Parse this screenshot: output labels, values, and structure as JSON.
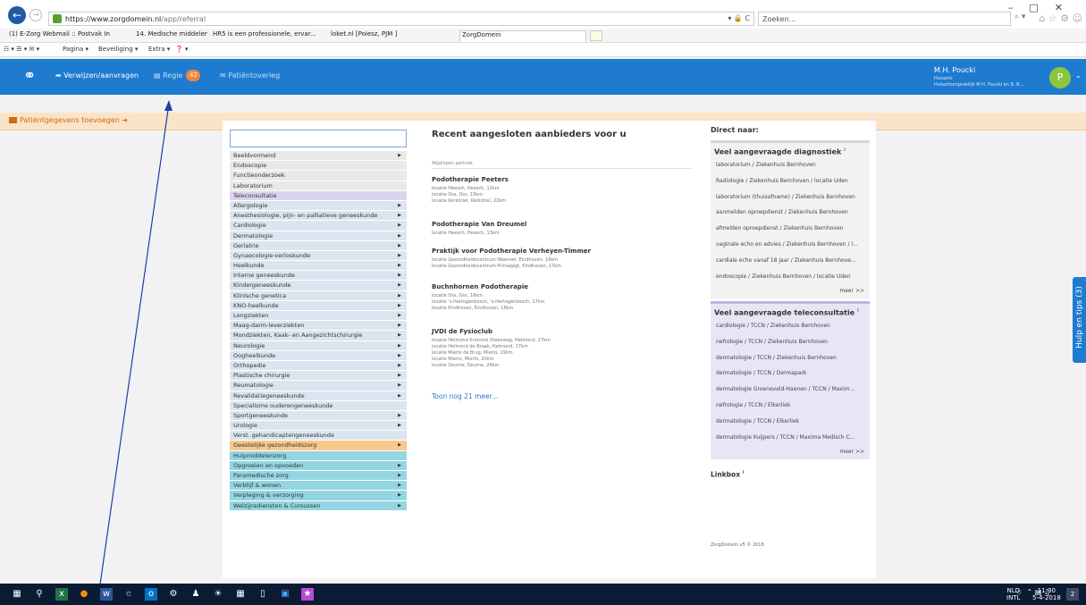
{
  "browser": {
    "url_host": "https://www.zorgdomein.nl",
    "url_path": "/app/referral",
    "url_tools": "▾ 🔒 C",
    "search_placeholder": "Zoeken...",
    "search_tools": "⌕ ▾",
    "tabs": [
      "(1) E-Zorg Webmail :: Postvak In",
      "14. Medische middelen",
      "HR5 is een professionele, ervar...",
      "loket.nl [Poiesz, PJM ]",
      "ZorgDomein"
    ],
    "command_items": [
      "Pagina ▾",
      "Beveiliging ▾",
      "Extra ▾"
    ]
  },
  "app": {
    "nav": {
      "referral": "Verwijzen/aanvragen",
      "regie": "Regie",
      "regie_count": "42",
      "patient_consult": "Patiëntoverleg"
    },
    "user": {
      "name": "M.H. Poucki",
      "role": "Huisarts",
      "practice": "Huisartsenpraktijk M.H. Poucki en B. R...",
      "initial": "P"
    },
    "add_patient": "Patiëntgegevens toevoegen"
  },
  "specialisms": [
    {
      "label": "Beeldvormend",
      "group": "grey",
      "arrow": true
    },
    {
      "label": "Endoscopie",
      "group": "grey",
      "arrow": false
    },
    {
      "label": "Functieonderzoek",
      "group": "grey",
      "arrow": false
    },
    {
      "label": "Laboratorium",
      "group": "grey",
      "arrow": false
    },
    {
      "label": "Teleconsultatie",
      "group": "purple",
      "arrow": false
    },
    {
      "label": "Allergologie",
      "group": "blue",
      "arrow": true
    },
    {
      "label": "Anesthesiologie, pijn- en palliatieve geneeskunde",
      "group": "blue",
      "arrow": true
    },
    {
      "label": "Cardiologie",
      "group": "blue",
      "arrow": true
    },
    {
      "label": "Dermatologie",
      "group": "blue",
      "arrow": true
    },
    {
      "label": "Geriatrie",
      "group": "blue",
      "arrow": true
    },
    {
      "label": "Gynaecologie-verloskunde",
      "group": "blue",
      "arrow": true
    },
    {
      "label": "Heelkunde",
      "group": "blue",
      "arrow": true
    },
    {
      "label": "Interne geneeskunde",
      "group": "blue",
      "arrow": true
    },
    {
      "label": "Kindergeneeskunde",
      "group": "blue",
      "arrow": true
    },
    {
      "label": "Klinische genetica",
      "group": "blue",
      "arrow": true
    },
    {
      "label": "KNO-heelkunde",
      "group": "blue",
      "arrow": true
    },
    {
      "label": "Longziekten",
      "group": "blue",
      "arrow": true
    },
    {
      "label": "Maag-darm-leverziekten",
      "group": "blue",
      "arrow": true
    },
    {
      "label": "Mondziekten, Kaak- en Aangezichtschirurgie",
      "group": "blue",
      "arrow": true
    },
    {
      "label": "Neurologie",
      "group": "blue",
      "arrow": true
    },
    {
      "label": "Oogheelkunde",
      "group": "blue",
      "arrow": true
    },
    {
      "label": "Orthopedie",
      "group": "blue",
      "arrow": true
    },
    {
      "label": "Plastische chirurgie",
      "group": "blue",
      "arrow": true
    },
    {
      "label": "Reumatologie",
      "group": "blue",
      "arrow": true
    },
    {
      "label": "Revalidatiegeneeskunde",
      "group": "blue",
      "arrow": true
    },
    {
      "label": "Specialisme ouderengeneeskunde",
      "group": "blue",
      "arrow": false
    },
    {
      "label": "Sportgeneeskunde",
      "group": "blue",
      "arrow": true
    },
    {
      "label": "Urologie",
      "group": "blue",
      "arrow": true
    },
    {
      "label": "Verst. gehandicaptengeneeskunde",
      "group": "blue",
      "arrow": false
    },
    {
      "label": "Geestelijke gezondheidszorg",
      "group": "orange",
      "arrow": true
    },
    {
      "label": "Hulpmiddelenzorg",
      "group": "teal",
      "arrow": false
    },
    {
      "label": "Opgroeien en opvoeden",
      "group": "teal",
      "arrow": true
    },
    {
      "label": "Paramedische zorg",
      "group": "teal",
      "arrow": true
    },
    {
      "label": "Verblijf & wonen",
      "group": "teal",
      "arrow": true
    },
    {
      "label": "Verpleging & verzorging",
      "group": "teal",
      "arrow": true
    },
    {
      "label": "Welzijnsdiensten & Cursussen",
      "group": "teal",
      "arrow": true
    }
  ],
  "recent": {
    "title": "Recent aangesloten aanbieders voor u",
    "period": "Afgelopen periode",
    "providers": [
      {
        "name": "Podotherapie Peeters",
        "locations": [
          "locatie Heesch, Heesch, 12km",
          "locatie Oss, Oss, 15km",
          "locatie Kerkdriel, Kerkdriel, 22km"
        ]
      },
      {
        "name": "Podotherapie Van Dreumel",
        "locations": [
          "locatie Heesch, Heesch, 13km"
        ]
      },
      {
        "name": "Praktijk voor Podotherapie Verheyen-Timmer",
        "locations": [
          "locatie Gezondheidscentrum Woensel, Eindhoven, 16km",
          "locatie Gezondheidscentrum Prinsejagt, Eindhoven, 17km"
        ]
      },
      {
        "name": "Buchnhornen Podotherapie",
        "locations": [
          "locatie Oss, Oss, 16km",
          "locatie 's-Hertogenbosch, 's-Hertogenbosch, 17km",
          "locatie Eindhoven, Eindhoven, 18km"
        ]
      },
      {
        "name": "JVDI de Fysioclub",
        "locations": [
          "locatie Helmond Kromme Steenweg, Helmond, 17km",
          "locatie Helmond de Braak, Helmond, 17km",
          "locatie Mierlo de Brug, Mierlo, 19km",
          "locatie Mierlo, Mierlo, 20km",
          "locatie Deurne, Deurne, 24km"
        ]
      }
    ],
    "more": "Toon nog 21 meer..."
  },
  "direct": {
    "title": "Direct naar:",
    "diagnostics_title": "Veel aangevraagde diagnostiek",
    "diagnostics": [
      "laboratorium / Ziekenhuis Bernhoven",
      "Radiologie / Ziekenhuis Bernhoven / locatie Uden",
      "laboratorium (thuisafname) / Ziekenhuis Bernhoven",
      "aanmelden oproepdienst / Ziekenhuis Bernhoven",
      "afmelden oproepdienst / Ziekenhuis Bernhoven",
      "vaginale echo en advies / Ziekenhuis Bernhoven / l...",
      "cardiale echo vanaf 18 jaar / Ziekenhuis Bernhove...",
      "endoscopie / Ziekenhuis Bernhoven / locatie Uden"
    ],
    "tele_title": "Veel aangevraagde teleconsultatie",
    "tele": [
      "cardiologie / TCCN / Ziekenhuis Bernhoven",
      "nefrologie / TCCN / Ziekenhuis Bernhoven",
      "dermatologie / TCCN / Ziekenhuis Bernhoven",
      "dermatologie / TCCN / Dermapark",
      "dermatologie Groeneveld-Haenen / TCCN / Maxim...",
      "nefrologie / TCCN / Elkerliek",
      "dermatologie / TCCN / Elkerliek",
      "dermatologie Kuijpers / TCCN / Maxima Medisch C..."
    ],
    "more": "meer >>",
    "linkbox": "Linkbox",
    "copyright": "ZorgDomein v5 © 2018"
  },
  "help_tab": "Hulp en tips (3)",
  "taskbar": {
    "lang_top": "NLD",
    "lang_bottom": "INTL",
    "time": "11:30",
    "date": "5-4-2018",
    "notifications": "2"
  },
  "colors": {
    "header_blue": "#1e7bd0",
    "badge_orange": "#f2843a",
    "avatar_green": "#8cc63f",
    "link_blue": "#2a78c8"
  }
}
